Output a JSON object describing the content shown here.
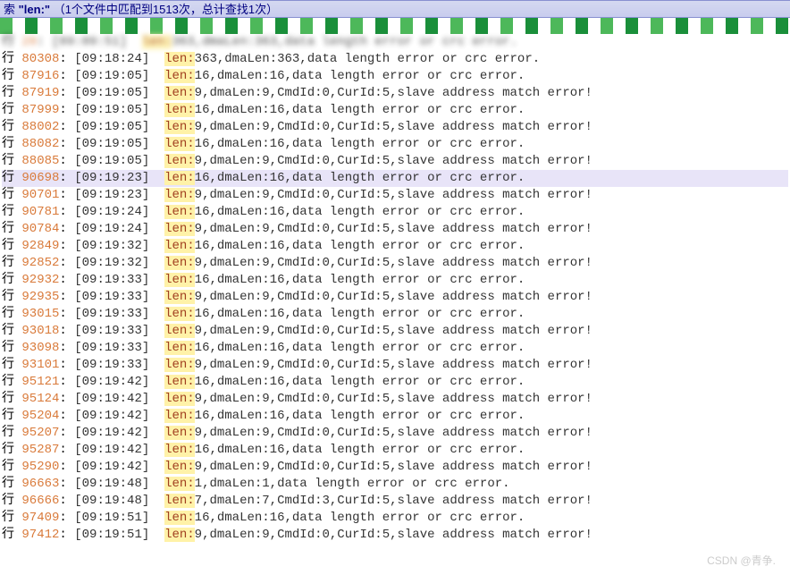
{
  "header": {
    "prefix": "索 ",
    "query": "\"len:\"",
    "summary": "   （1个文件中匹配到1513次，总计查找1次）"
  },
  "line_label": "行 ",
  "highlight_token": "len:",
  "rows": [
    {
      "num": "28",
      "ts": "[09:09:51]",
      "rest": "363,dmaLen:363,data length error or crc error.",
      "blur": true
    },
    {
      "num": "80308",
      "ts": "[09:18:24]",
      "rest": "363,dmaLen:363,data length error or crc error."
    },
    {
      "num": "87916",
      "ts": "[09:19:05]",
      "rest": "16,dmaLen:16,data length error or crc error."
    },
    {
      "num": "87919",
      "ts": "[09:19:05]",
      "rest": "9,dmaLen:9,CmdId:0,CurId:5,slave address match error!"
    },
    {
      "num": "87999",
      "ts": "[09:19:05]",
      "rest": "16,dmaLen:16,data length error or crc error."
    },
    {
      "num": "88002",
      "ts": "[09:19:05]",
      "rest": "9,dmaLen:9,CmdId:0,CurId:5,slave address match error!"
    },
    {
      "num": "88082",
      "ts": "[09:19:05]",
      "rest": "16,dmaLen:16,data length error or crc error."
    },
    {
      "num": "88085",
      "ts": "[09:19:05]",
      "rest": "9,dmaLen:9,CmdId:0,CurId:5,slave address match error!"
    },
    {
      "num": "90698",
      "ts": "[09:19:23]",
      "rest": "16,dmaLen:16,data length error or crc error.",
      "highlight": true
    },
    {
      "num": "90701",
      "ts": "[09:19:23]",
      "rest": "9,dmaLen:9,CmdId:0,CurId:5,slave address match error!"
    },
    {
      "num": "90781",
      "ts": "[09:19:24]",
      "rest": "16,dmaLen:16,data length error or crc error."
    },
    {
      "num": "90784",
      "ts": "[09:19:24]",
      "rest": "9,dmaLen:9,CmdId:0,CurId:5,slave address match error!"
    },
    {
      "num": "92849",
      "ts": "[09:19:32]",
      "rest": "16,dmaLen:16,data length error or crc error."
    },
    {
      "num": "92852",
      "ts": "[09:19:32]",
      "rest": "9,dmaLen:9,CmdId:0,CurId:5,slave address match error!"
    },
    {
      "num": "92932",
      "ts": "[09:19:33]",
      "rest": "16,dmaLen:16,data length error or crc error."
    },
    {
      "num": "92935",
      "ts": "[09:19:33]",
      "rest": "9,dmaLen:9,CmdId:0,CurId:5,slave address match error!"
    },
    {
      "num": "93015",
      "ts": "[09:19:33]",
      "rest": "16,dmaLen:16,data length error or crc error."
    },
    {
      "num": "93018",
      "ts": "[09:19:33]",
      "rest": "9,dmaLen:9,CmdId:0,CurId:5,slave address match error!"
    },
    {
      "num": "93098",
      "ts": "[09:19:33]",
      "rest": "16,dmaLen:16,data length error or crc error."
    },
    {
      "num": "93101",
      "ts": "[09:19:33]",
      "rest": "9,dmaLen:9,CmdId:0,CurId:5,slave address match error!"
    },
    {
      "num": "95121",
      "ts": "[09:19:42]",
      "rest": "16,dmaLen:16,data length error or crc error."
    },
    {
      "num": "95124",
      "ts": "[09:19:42]",
      "rest": "9,dmaLen:9,CmdId:0,CurId:5,slave address match error!"
    },
    {
      "num": "95204",
      "ts": "[09:19:42]",
      "rest": "16,dmaLen:16,data length error or crc error."
    },
    {
      "num": "95207",
      "ts": "[09:19:42]",
      "rest": "9,dmaLen:9,CmdId:0,CurId:5,slave address match error!"
    },
    {
      "num": "95287",
      "ts": "[09:19:42]",
      "rest": "16,dmaLen:16,data length error or crc error."
    },
    {
      "num": "95290",
      "ts": "[09:19:42]",
      "rest": "9,dmaLen:9,CmdId:0,CurId:5,slave address match error!"
    },
    {
      "num": "96663",
      "ts": "[09:19:48]",
      "rest": "1,dmaLen:1,data length error or crc error."
    },
    {
      "num": "96666",
      "ts": "[09:19:48]",
      "rest": "7,dmaLen:7,CmdId:3,CurId:5,slave address match error!"
    },
    {
      "num": "97409",
      "ts": "[09:19:51]",
      "rest": "16,dmaLen:16,data length error or crc error."
    },
    {
      "num": "97412",
      "ts": "[09:19:51]",
      "rest": "9,dmaLen:9,CmdId:0,CurId:5,slave address match error!"
    }
  ],
  "watermark": "CSDN @青争."
}
